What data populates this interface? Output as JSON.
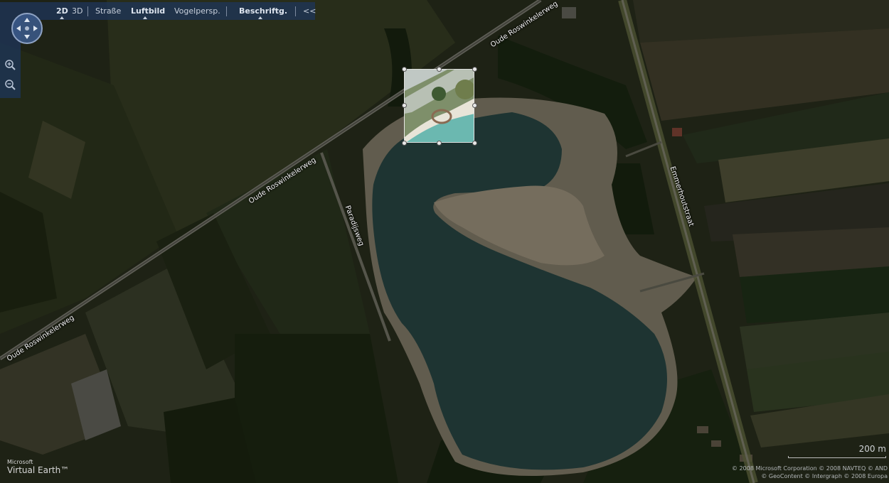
{
  "toolbar": {
    "view_2d": "2D",
    "view_3d": "3D",
    "road": "Straße",
    "aerial": "Luftbild",
    "birdseye": "Vogelpersp.",
    "labels": "Beschriftg.",
    "collapse": "<<"
  },
  "nav": {
    "compass_icon": "compass-pan-icon",
    "zoom_in_icon": "zoom-in-icon",
    "zoom_out_icon": "zoom-out-icon"
  },
  "map": {
    "roads": [
      {
        "name": "Oude Roswinkelerweg"
      },
      {
        "name": "Oude Roswinkelerweg"
      },
      {
        "name": "Oude Roswinkelerweg"
      },
      {
        "name": "Paradijsweg"
      },
      {
        "name": "Emmerhoutstraat"
      }
    ]
  },
  "scale": {
    "label": "200 m"
  },
  "branding": {
    "line1": "Microsoft",
    "line2": "Virtual Earth™"
  },
  "copyright": {
    "line1": "© 2008 Microsoft Corporation   © 2008 NAVTEQ   © AND",
    "line2": "© GeoContent   © Intergraph   © 2008 Europa"
  },
  "colors": {
    "toolbar_bg": "#1e3456",
    "lake": "#2c4b48",
    "sand": "#8c8470",
    "highlight_water": "#6bb8b0"
  }
}
